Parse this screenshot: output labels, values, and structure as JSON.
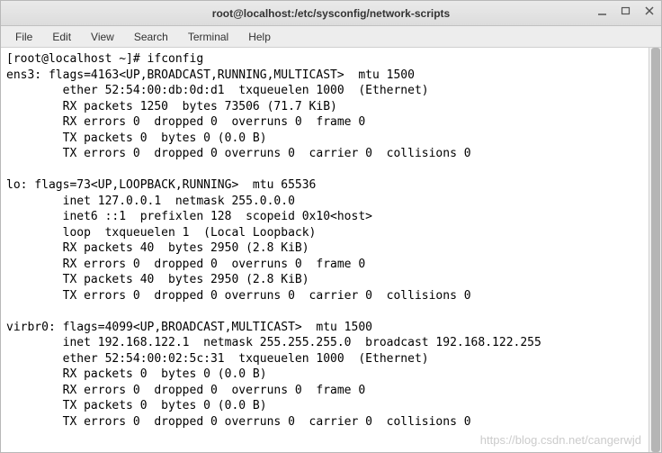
{
  "window": {
    "title": "root@localhost:/etc/sysconfig/network-scripts"
  },
  "menu": {
    "file": "File",
    "edit": "Edit",
    "view": "View",
    "search": "Search",
    "terminal": "Terminal",
    "help": "Help"
  },
  "terminal": {
    "prompt": "[root@localhost ~]# ",
    "command": "ifconfig",
    "output": "ens3: flags=4163<UP,BROADCAST,RUNNING,MULTICAST>  mtu 1500\n        ether 52:54:00:db:0d:d1  txqueuelen 1000  (Ethernet)\n        RX packets 1250  bytes 73506 (71.7 KiB)\n        RX errors 0  dropped 0  overruns 0  frame 0\n        TX packets 0  bytes 0 (0.0 B)\n        TX errors 0  dropped 0 overruns 0  carrier 0  collisions 0\n\nlo: flags=73<UP,LOOPBACK,RUNNING>  mtu 65536\n        inet 127.0.0.1  netmask 255.0.0.0\n        inet6 ::1  prefixlen 128  scopeid 0x10<host>\n        loop  txqueuelen 1  (Local Loopback)\n        RX packets 40  bytes 2950 (2.8 KiB)\n        RX errors 0  dropped 0  overruns 0  frame 0\n        TX packets 40  bytes 2950 (2.8 KiB)\n        TX errors 0  dropped 0 overruns 0  carrier 0  collisions 0\n\nvirbr0: flags=4099<UP,BROADCAST,MULTICAST>  mtu 1500\n        inet 192.168.122.1  netmask 255.255.255.0  broadcast 192.168.122.255\n        ether 52:54:00:02:5c:31  txqueuelen 1000  (Ethernet)\n        RX packets 0  bytes 0 (0.0 B)\n        RX errors 0  dropped 0  overruns 0  frame 0\n        TX packets 0  bytes 0 (0.0 B)\n        TX errors 0  dropped 0 overruns 0  carrier 0  collisions 0"
  },
  "watermark": "https://blog.csdn.net/cangerwjd"
}
